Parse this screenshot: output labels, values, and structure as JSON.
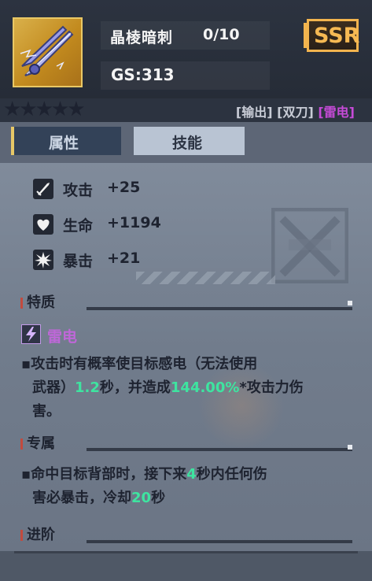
{
  "item": {
    "name": "晶棱暗刺",
    "level": "0/10",
    "gs": "GS:313",
    "rarity": "SSR",
    "stars_text": "★★★★★",
    "icon": "crystal-dual-blades-icon"
  },
  "tags": {
    "role": "[输出]",
    "weapon": "[双刀]",
    "element": "[雷电]",
    "element_color": "#c64bd8"
  },
  "tabs": {
    "attributes": "属性",
    "skills": "技能"
  },
  "stats": [
    {
      "name": "攻击",
      "value": "+25",
      "icon": "sword-icon"
    },
    {
      "name": "生命",
      "value": "+1194",
      "icon": "heart-icon"
    },
    {
      "name": "暴击",
      "value": "+21",
      "icon": "crit-burst-icon"
    }
  ],
  "traits": {
    "title": "特质",
    "element_icon": "lightning-icon",
    "element_name": "雷电",
    "desc_1": "攻击时有概率使目标感电（无法使用",
    "desc_2a": "武器）",
    "desc_2b": "1.2",
    "desc_2c": "秒，并造成",
    "desc_2d": "144.00%",
    "desc_2e": "*攻击力伤",
    "desc_3": "害。"
  },
  "exclusive": {
    "title": "专属",
    "desc_1a": "命中目标背部时，接下来",
    "desc_1b": "4",
    "desc_1c": "秒内任何伤",
    "desc_2a": "害必暴击，冷却",
    "desc_2b": "20",
    "desc_2c": "秒"
  },
  "advance": {
    "title": "进阶"
  },
  "colors": {
    "highlight_green": "#3ee4a0",
    "rarity_gold": "#f2b44e",
    "element_purple": "#bf67d8"
  }
}
